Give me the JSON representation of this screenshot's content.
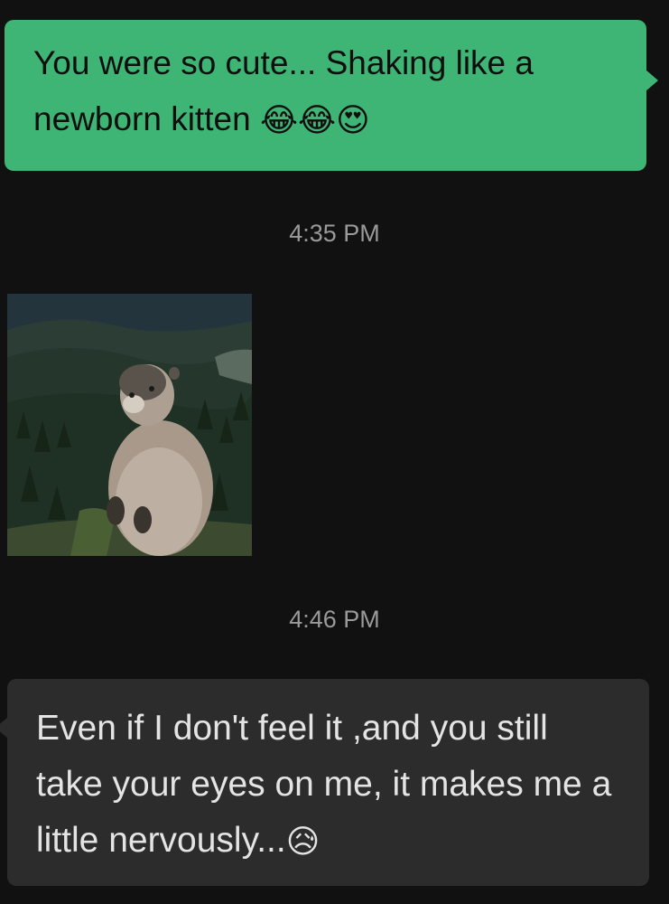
{
  "messages": [
    {
      "direction": "outgoing",
      "text": "You were so cute... Shaking like a newborn kitten ",
      "emojis": [
        "😂",
        "😂",
        "😍"
      ]
    },
    {
      "timestamp": "4:35 PM"
    },
    {
      "direction": "incoming",
      "type": "image",
      "image_subject": "marmot standing upright on a forested mountainside"
    },
    {
      "timestamp": "4:46 PM"
    },
    {
      "direction": "incoming",
      "text": "Even if I don't feel it ,and you still take your eyes on me, it makes me a little nervously...",
      "emojis": [
        "😥"
      ]
    }
  ],
  "colors": {
    "background": "#111111",
    "outgoing_bubble": "#3eb575",
    "incoming_bubble": "#2c2c2c",
    "timestamp": "#9a9a9a"
  }
}
